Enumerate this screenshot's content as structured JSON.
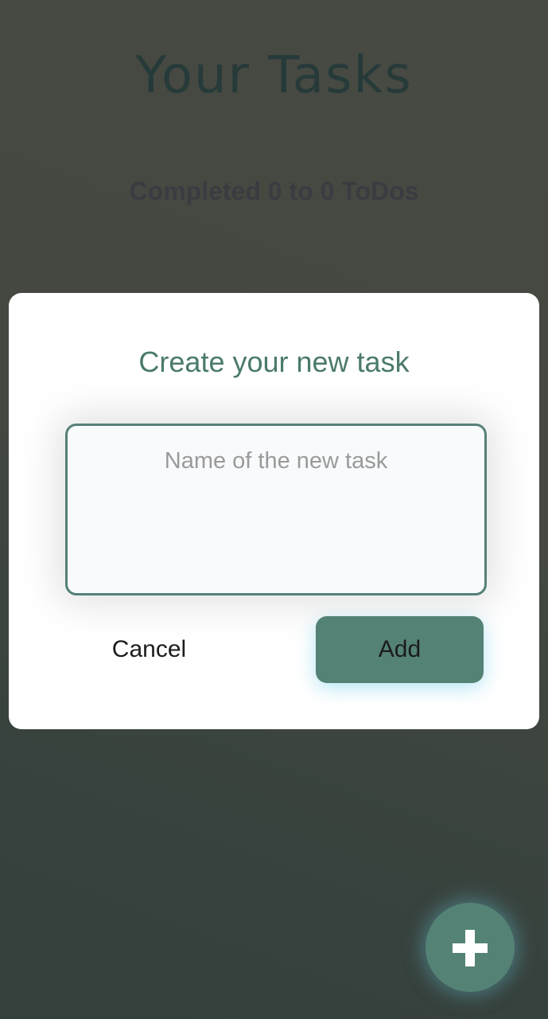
{
  "header": {
    "title": "Your Tasks",
    "subtitle": "Completed 0 to 0 ToDos"
  },
  "dialog": {
    "title": "Create your new task",
    "input": {
      "value": "",
      "placeholder": "Name of the new task"
    },
    "cancel_label": "Cancel",
    "add_label": "Add"
  },
  "fab": {
    "icon": "plus-icon"
  },
  "colors": {
    "accent": "#548275",
    "title": "#4a7a6b"
  }
}
